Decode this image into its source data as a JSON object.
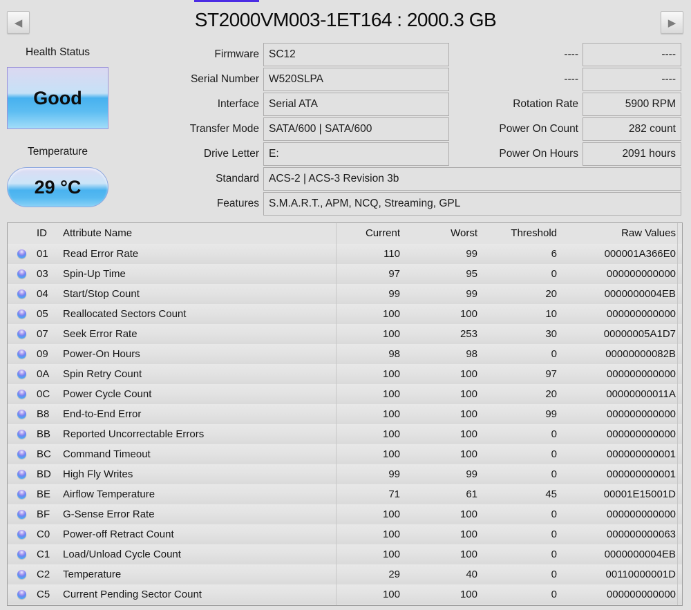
{
  "window": {
    "title": "ST2000VM003-1ET164 : 2000.3 GB"
  },
  "nav": {
    "prev_icon": "◀",
    "next_icon": "▶"
  },
  "health": {
    "label": "Health Status",
    "status": "Good"
  },
  "temperature": {
    "label": "Temperature",
    "value": "29 °C"
  },
  "info_left": [
    {
      "label": "Firmware",
      "value": "SC12"
    },
    {
      "label": "Serial Number",
      "value": "W520SLPA"
    },
    {
      "label": "Interface",
      "value": "Serial ATA"
    },
    {
      "label": "Transfer Mode",
      "value": "SATA/600 | SATA/600"
    },
    {
      "label": "Drive Letter",
      "value": "E:"
    },
    {
      "label": "Standard",
      "value": "ACS-2 | ACS-3 Revision 3b"
    },
    {
      "label": "Features",
      "value": "S.M.A.R.T., APM, NCQ, Streaming, GPL"
    }
  ],
  "info_right": [
    {
      "label": "----",
      "value": "----"
    },
    {
      "label": "----",
      "value": "----"
    },
    {
      "label": "Rotation Rate",
      "value": "5900 RPM"
    },
    {
      "label": "Power On Count",
      "value": "282 count"
    },
    {
      "label": "Power On Hours",
      "value": "2091 hours"
    }
  ],
  "table": {
    "headers": {
      "id": "ID",
      "name": "Attribute Name",
      "current": "Current",
      "worst": "Worst",
      "threshold": "Threshold",
      "raw": "Raw Values"
    },
    "rows": [
      {
        "id": "01",
        "name": "Read Error Rate",
        "current": "110",
        "worst": "99",
        "threshold": "6",
        "raw": "000001A366E0"
      },
      {
        "id": "03",
        "name": "Spin-Up Time",
        "current": "97",
        "worst": "95",
        "threshold": "0",
        "raw": "000000000000"
      },
      {
        "id": "04",
        "name": "Start/Stop Count",
        "current": "99",
        "worst": "99",
        "threshold": "20",
        "raw": "0000000004EB"
      },
      {
        "id": "05",
        "name": "Reallocated Sectors Count",
        "current": "100",
        "worst": "100",
        "threshold": "10",
        "raw": "000000000000"
      },
      {
        "id": "07",
        "name": "Seek Error Rate",
        "current": "100",
        "worst": "253",
        "threshold": "30",
        "raw": "00000005A1D7"
      },
      {
        "id": "09",
        "name": "Power-On Hours",
        "current": "98",
        "worst": "98",
        "threshold": "0",
        "raw": "00000000082B"
      },
      {
        "id": "0A",
        "name": "Spin Retry Count",
        "current": "100",
        "worst": "100",
        "threshold": "97",
        "raw": "000000000000"
      },
      {
        "id": "0C",
        "name": "Power Cycle Count",
        "current": "100",
        "worst": "100",
        "threshold": "20",
        "raw": "00000000011A"
      },
      {
        "id": "B8",
        "name": "End-to-End Error",
        "current": "100",
        "worst": "100",
        "threshold": "99",
        "raw": "000000000000"
      },
      {
        "id": "BB",
        "name": "Reported Uncorrectable Errors",
        "current": "100",
        "worst": "100",
        "threshold": "0",
        "raw": "000000000000"
      },
      {
        "id": "BC",
        "name": "Command Timeout",
        "current": "100",
        "worst": "100",
        "threshold": "0",
        "raw": "000000000001"
      },
      {
        "id": "BD",
        "name": "High Fly Writes",
        "current": "99",
        "worst": "99",
        "threshold": "0",
        "raw": "000000000001"
      },
      {
        "id": "BE",
        "name": "Airflow Temperature",
        "current": "71",
        "worst": "61",
        "threshold": "45",
        "raw": "00001E15001D"
      },
      {
        "id": "BF",
        "name": "G-Sense Error Rate",
        "current": "100",
        "worst": "100",
        "threshold": "0",
        "raw": "000000000000"
      },
      {
        "id": "C0",
        "name": "Power-off Retract Count",
        "current": "100",
        "worst": "100",
        "threshold": "0",
        "raw": "000000000063"
      },
      {
        "id": "C1",
        "name": "Load/Unload Cycle Count",
        "current": "100",
        "worst": "100",
        "threshold": "0",
        "raw": "0000000004EB"
      },
      {
        "id": "C2",
        "name": "Temperature",
        "current": "29",
        "worst": "40",
        "threshold": "0",
        "raw": "00110000001D"
      },
      {
        "id": "C5",
        "name": "Current Pending Sector Count",
        "current": "100",
        "worst": "100",
        "threshold": "0",
        "raw": "000000000000"
      }
    ]
  },
  "colors": {
    "background": "#e1e1e1",
    "accent_line": "#4b2ce4",
    "health_gradient_blue": "#47b1ef",
    "health_border": "#9b92d9",
    "temp_border": "#8fa9e0",
    "dot_purple": "#a89af2",
    "dot_blue": "#4aa6f4"
  }
}
